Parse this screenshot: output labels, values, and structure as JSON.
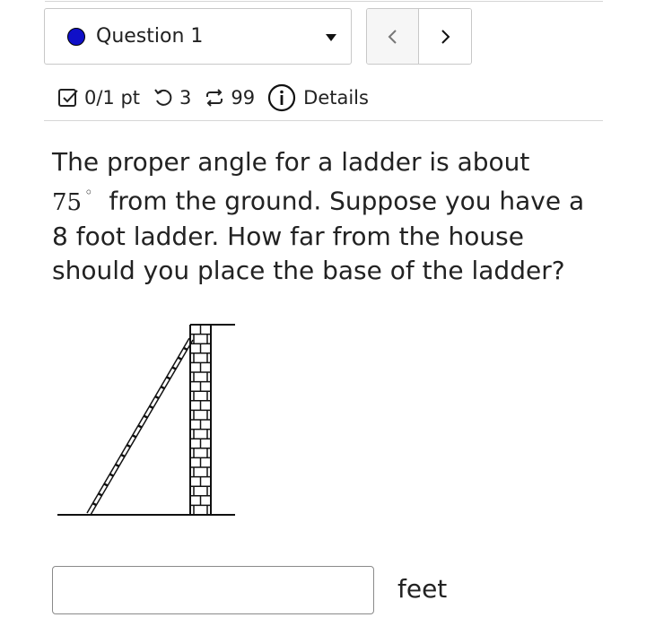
{
  "question_selector": {
    "label": "Question 1",
    "status_color": "#1010c8"
  },
  "nav": {
    "prev_icon": "chevron-left-icon",
    "next_icon": "chevron-right-icon"
  },
  "meta": {
    "points": "0/1 pt",
    "attempts_left": "3",
    "versions": "99",
    "details_label": "Details"
  },
  "question": {
    "text_before": "The proper angle for a ladder is about",
    "angle_value": "75",
    "angle_unit": "◦",
    "text_after": "from the ground. Suppose you have a 8 foot ladder. How far from the house should you place the base of the ladder?"
  },
  "answer": {
    "value": "",
    "unit": "feet"
  }
}
